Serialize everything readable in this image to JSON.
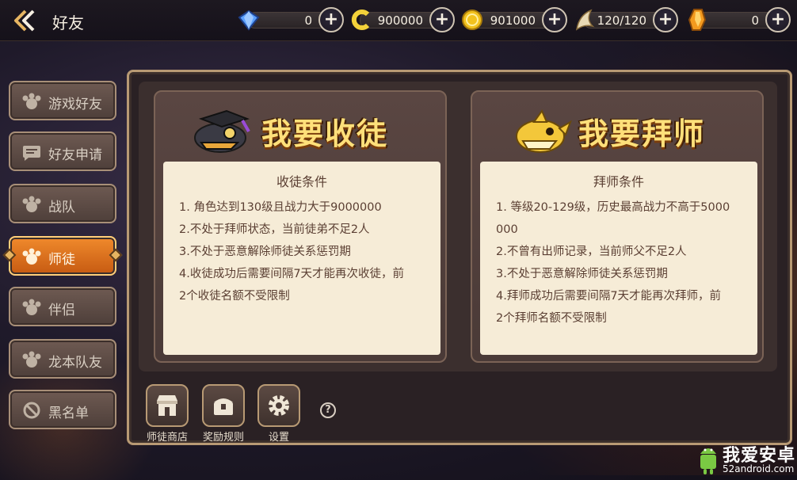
{
  "header": {
    "title": "好友"
  },
  "resources": [
    {
      "name": "diamond",
      "icon": "blue-diamond-icon",
      "value": "0"
    },
    {
      "name": "coin-c",
      "icon": "c-currency-icon",
      "value": "900000"
    },
    {
      "name": "gold",
      "icon": "gold-coin-icon",
      "value": "901000"
    },
    {
      "name": "stamina",
      "icon": "wing-icon",
      "value": "120/120"
    },
    {
      "name": "crystal",
      "icon": "orange-crystal-icon",
      "value": "0"
    }
  ],
  "sidebar": {
    "items": [
      {
        "label": "游戏好友"
      },
      {
        "label": "好友申请"
      },
      {
        "label": "战队"
      },
      {
        "label": "师徒"
      },
      {
        "label": "伴侣"
      },
      {
        "label": "龙本队友"
      },
      {
        "label": "黑名单"
      }
    ],
    "active_index": 3
  },
  "cards": {
    "recruit": {
      "heading": "我要收徒",
      "cond_title": "收徒条件",
      "lines": [
        "1. 角色达到130级且战力大于9000000",
        "2.不处于拜师状态，当前徒弟不足2人",
        "3.不处于恶意解除师徒关系惩罚期",
        "4.收徒成功后需要间隔7天才能再次收徒，前",
        "2个收徒名额不受限制"
      ]
    },
    "apprentice": {
      "heading": "我要拜师",
      "cond_title": "拜师条件",
      "lines": [
        "1. 等级20-129级，历史最高战力不高于5000",
        "000",
        "2.不曾有出师记录，当前师父不足2人",
        "3.不处于恶意解除师徒关系惩罚期",
        "4.拜师成功后需要间隔7天才能再次拜师，前",
        "2个拜师名额不受限制"
      ]
    }
  },
  "bottom": {
    "shop_label": "师徒商店",
    "reward_label": "奖励规则",
    "settings_label": "设置",
    "help_label": "?"
  },
  "watermark": {
    "brand": "我爱安卓",
    "site": "52android.com"
  },
  "colors": {
    "accent_orange": "#e0741e",
    "frame_gold": "#b89a74",
    "heading_yellow": "#ffe07a"
  }
}
